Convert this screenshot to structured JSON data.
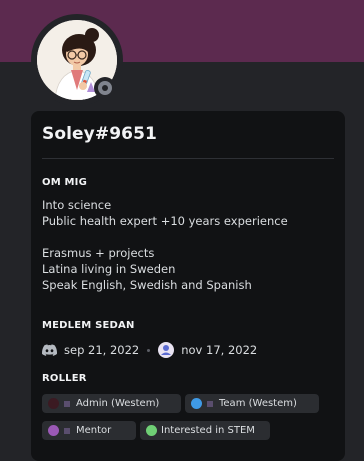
{
  "profile": {
    "username": "Soley#9651",
    "avatar_icon": "cartoon-woman-avatar-icon",
    "status_icon": "offline-status-icon"
  },
  "about": {
    "title": "OM MIG",
    "lines": [
      "Into science",
      "Public health expert +10 years experience",
      "",
      "Erasmus + projects",
      "Latina living in Sweden",
      "Speak English, Swedish and Spanish"
    ]
  },
  "member_since": {
    "title": "MEDLEM SEDAN",
    "discord_icon": "discord-icon",
    "discord_date": "sep 21, 2022",
    "server_icon": "server-icon",
    "server_date": "nov 17, 2022"
  },
  "roles": {
    "title": "ROLLER",
    "items": [
      {
        "label": "Admin (Westem)",
        "color": "#3b1a22",
        "has_emoji": true
      },
      {
        "label": "Team (Westem)",
        "color": "#3f9ae6",
        "has_emoji": true
      },
      {
        "label": "Mentor",
        "color": "#9b59b6",
        "has_emoji": true
      },
      {
        "label": "Interested in STEM",
        "color": "#6fcf75",
        "has_emoji": false
      }
    ]
  },
  "colors": {
    "banner": "#5c2a4f",
    "card": "#111214",
    "background": "#232428"
  }
}
